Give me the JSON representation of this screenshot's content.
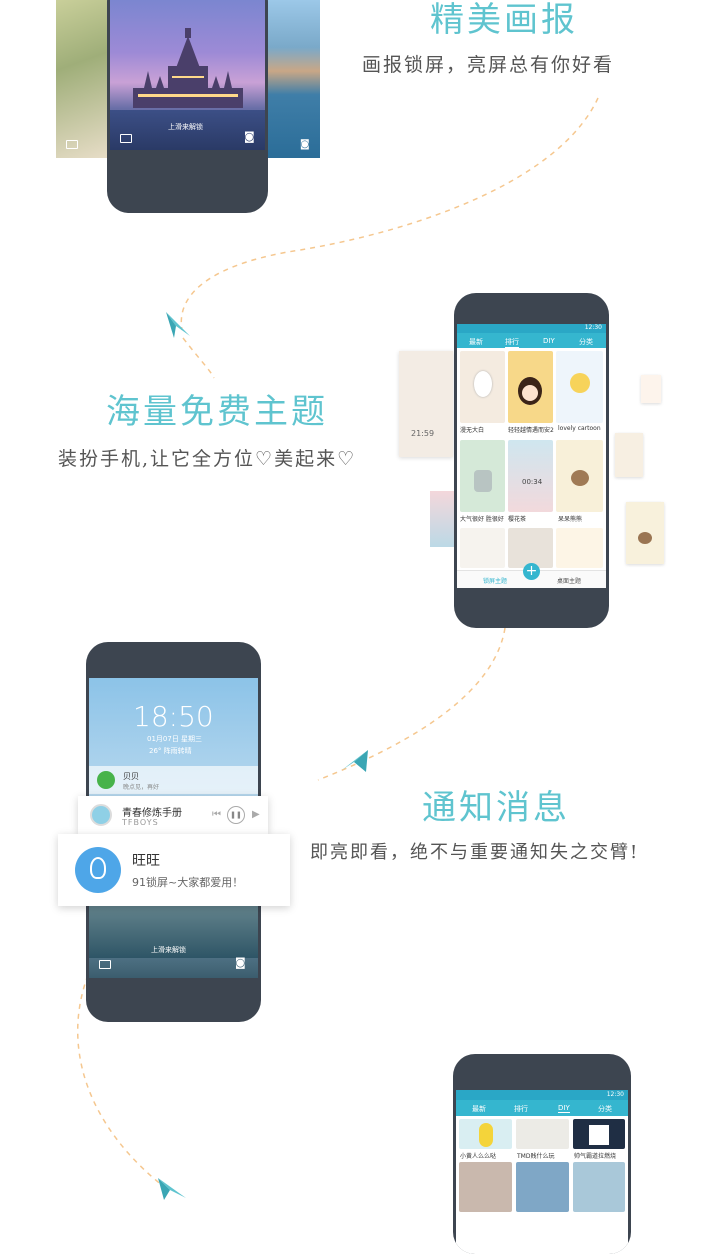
{
  "section1": {
    "title": "精美画报",
    "subtitle": "画报锁屏，亮屏总有你好看",
    "lock_hint": "上滑来解锁"
  },
  "section2": {
    "title": "海量免费主题",
    "subtitle": "装扮手机,让它全方位♡美起来♡",
    "status_time": "12:30",
    "tabs": [
      "最新",
      "排行",
      "DIY",
      "分类"
    ],
    "themes": [
      "漫无大白",
      "轻轻越情遇而安2",
      "lovely cartoon",
      "大气很好 胜很好",
      "樱花茶",
      "呆呆熊熊"
    ],
    "bottom_tabs": [
      "锁屏主题",
      "桌面主题"
    ],
    "mini_clock": "21:59",
    "mini_time": "00:34"
  },
  "section3": {
    "title": "通知消息",
    "subtitle": "即亮即看，绝不与重要通知失之交臂!",
    "clock": "18:50",
    "date": "01月07日  星期三",
    "weather": "26° 阵雨转晴",
    "wechat_name": "贝贝",
    "wechat_msg": "晚点见，再好",
    "music_title": "青春修炼手册",
    "music_artist": "TFBOYS",
    "qq_name": "旺旺",
    "qq_msg": "91锁屏~大家都爱用！",
    "unlock_hint": "上滑来解锁"
  },
  "section4": {
    "status_time": "12:30",
    "tabs": [
      "最新",
      "排行",
      "DIY",
      "分类"
    ],
    "items": [
      "小黄人么么哒",
      "TMD贱什么玩",
      "帅气霸道拉燃烧"
    ]
  },
  "colors": {
    "accent": "#5fc4cf",
    "phone": "#3d4550",
    "dash": "#f5c78f"
  }
}
